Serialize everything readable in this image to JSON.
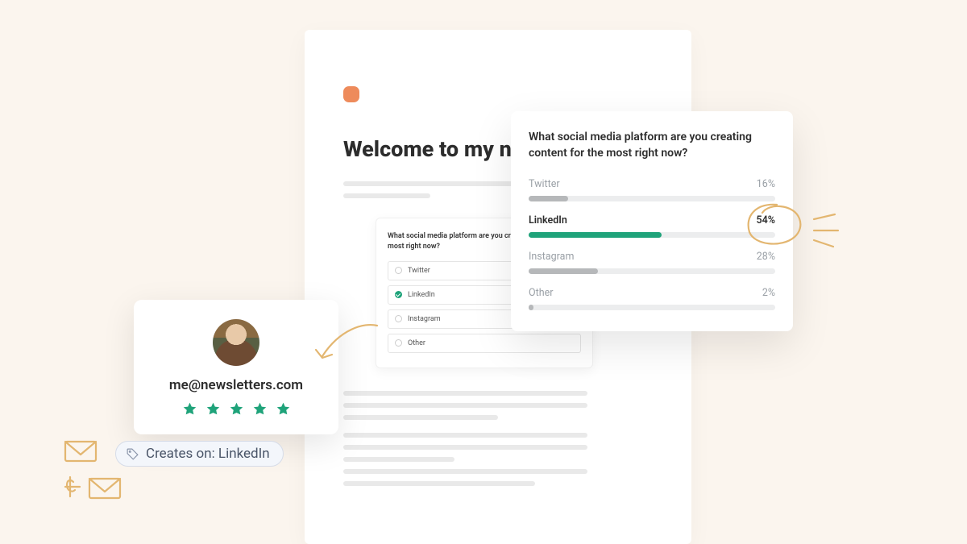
{
  "newsletter": {
    "heading": "Welcome to my newsletter!"
  },
  "poll": {
    "question": "What social media platform are you creating content for the most right now?",
    "options": [
      "Twitter",
      "LinkedIn",
      "Instagram",
      "Other"
    ],
    "selected_index": 1
  },
  "results": {
    "question": "What social media platform are you creating content for the most right now?",
    "rows": [
      {
        "label": "Twitter",
        "pct": 16
      },
      {
        "label": "LinkedIn",
        "pct": 54
      },
      {
        "label": "Instagram",
        "pct": 28
      },
      {
        "label": "Other",
        "pct": 2
      }
    ],
    "highlight_index": 1
  },
  "profile": {
    "email": "me@newsletters.com",
    "stars": 5,
    "tag_label": "Creates on: LinkedIn"
  },
  "colors": {
    "accent_green": "#1FA37A",
    "accent_orange": "#EE8B5B",
    "sketch": "#E3B670"
  }
}
